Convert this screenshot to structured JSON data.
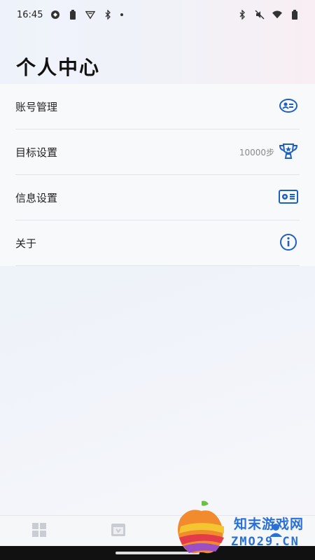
{
  "status_bar": {
    "time": "16:45"
  },
  "page": {
    "title": "个人中心"
  },
  "menu": {
    "items": [
      {
        "label": "账号管理",
        "value": "",
        "icon": "account-badge-icon"
      },
      {
        "label": "目标设置",
        "value": "10000步",
        "icon": "trophy-icon"
      },
      {
        "label": "信息设置",
        "value": "",
        "icon": "id-card-icon"
      },
      {
        "label": "关于",
        "value": "",
        "icon": "info-icon"
      }
    ]
  },
  "tab_bar": {
    "tabs": [
      {
        "icon": "grid-icon"
      },
      {
        "icon": "calendar-icon"
      },
      {
        "icon": "home-icon"
      },
      {
        "icon": "profile-icon"
      }
    ]
  },
  "watermark": {
    "line1": "知末游戏网",
    "line2": "ZMO29.CN"
  },
  "colors": {
    "accent": "#2a6fd6",
    "menu_icon": "#1f5fbf"
  }
}
